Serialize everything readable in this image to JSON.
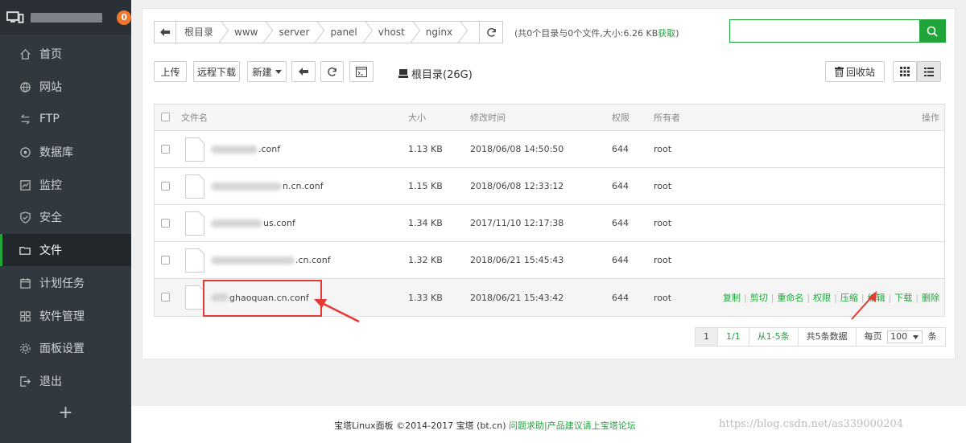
{
  "sidebar": {
    "badge_count": "0",
    "items": [
      {
        "label": "首页",
        "icon": "home-icon"
      },
      {
        "label": "网站",
        "icon": "globe-icon"
      },
      {
        "label": "FTP",
        "icon": "ftp-icon"
      },
      {
        "label": "数据库",
        "icon": "database-icon"
      },
      {
        "label": "监控",
        "icon": "monitor-icon"
      },
      {
        "label": "安全",
        "icon": "shield-icon"
      },
      {
        "label": "文件",
        "icon": "folder-icon"
      },
      {
        "label": "计划任务",
        "icon": "calendar-icon"
      },
      {
        "label": "软件管理",
        "icon": "apps-icon"
      },
      {
        "label": "面板设置",
        "icon": "gear-icon"
      },
      {
        "label": "退出",
        "icon": "logout-icon"
      }
    ],
    "add_label": "+"
  },
  "path": {
    "crumbs": [
      "根目录",
      "www",
      "server",
      "panel",
      "vhost",
      "nginx"
    ],
    "info": "(共0个目录与0个文件,大小:6.26 KB",
    "info_link": "获取",
    "info_end": ")"
  },
  "search": {
    "value": "",
    "placeholder": ""
  },
  "toolbar": {
    "upload": "上传",
    "remote_download": "远程下载",
    "new": "新建",
    "disk": "根目录(26G)",
    "recycle": "回收站"
  },
  "table": {
    "headers": {
      "name": "文件名",
      "size": "大小",
      "mtime": "修改时间",
      "perm": "权限",
      "owner": "所有者",
      "ops": "操作"
    },
    "rows": [
      {
        "name": ".conf",
        "size": "1.13 KB",
        "mtime": "2018/06/08 14:50:50",
        "perm": "644",
        "owner": "root"
      },
      {
        "name": "n.cn.conf",
        "size": "1.15 KB",
        "mtime": "2018/06/08 12:33:12",
        "perm": "644",
        "owner": "root"
      },
      {
        "name": "us.conf",
        "size": "1.34 KB",
        "mtime": "2017/11/10 12:17:38",
        "perm": "644",
        "owner": "root"
      },
      {
        "name": ".cn.conf",
        "size": "1.32 KB",
        "mtime": "2018/06/21 15:45:43",
        "perm": "644",
        "owner": "root"
      },
      {
        "name": "ghaoquan.cn.conf",
        "size": "1.33 KB",
        "mtime": "2018/06/21 15:43:42",
        "perm": "644",
        "owner": "root"
      }
    ],
    "row_ops": [
      "复制",
      "剪切",
      "重命名",
      "权限",
      "压缩",
      "编辑",
      "下载",
      "删除"
    ]
  },
  "pager": {
    "current": "1",
    "pages": "1/1",
    "range": "从1-5条",
    "total": "共5条数据",
    "per_page_label": "每页",
    "per_page": "100",
    "unit": "条"
  },
  "footer": {
    "copyright": "宝塔Linux面板 ©2014-2017 宝塔 (bt.cn)",
    "link": "问题求助|产品建议请上宝塔论坛",
    "watermark": "https://blog.csdn.net/as339000204"
  },
  "colors": {
    "accent": "#20a53a",
    "sidebar": "#32383f",
    "badge": "#f0772b",
    "highlight": "#e53935"
  }
}
